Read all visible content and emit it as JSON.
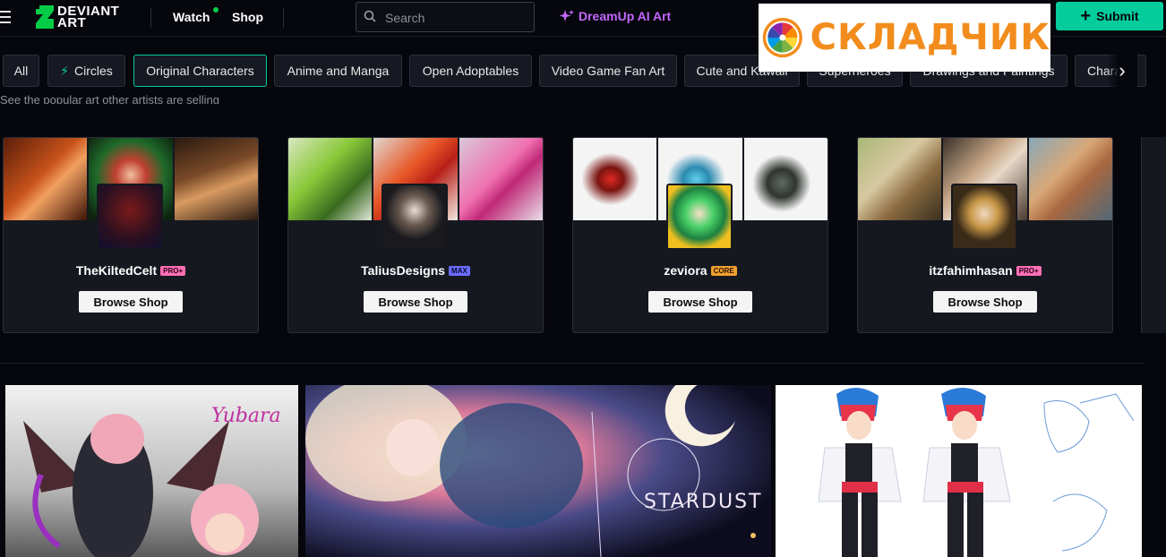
{
  "header": {
    "logo_line1": "DEVIANT",
    "logo_line2": "ART",
    "watch_label": "Watch",
    "shop_label": "Shop",
    "search_placeholder": "Search",
    "dreamup_label": "DreamUp AI Art",
    "submit_label": "Submit"
  },
  "watermark": {
    "text": "СКЛАДЧИК"
  },
  "categories": [
    {
      "label": "All"
    },
    {
      "label": "Circles"
    },
    {
      "label": "Original Characters",
      "active": true
    },
    {
      "label": "Anime and Manga"
    },
    {
      "label": "Open Adoptables"
    },
    {
      "label": "Video Game Fan Art"
    },
    {
      "label": "Cute and Kawaii"
    },
    {
      "label": "Superheroes"
    },
    {
      "label": "Drawings and Paintings"
    },
    {
      "label": "Characte"
    }
  ],
  "section": {
    "subtitle": "See the popular art other artists are selling"
  },
  "shops": [
    {
      "username": "TheKiltedCelt",
      "badge": "PRO+",
      "badge_color": "#ff6fb5",
      "button_label": "Browse Shop"
    },
    {
      "username": "TaliusDesigns",
      "badge": "MAX",
      "badge_color": "#6c6cff",
      "button_label": "Browse Shop"
    },
    {
      "username": "zeviora",
      "badge": "CORE",
      "badge_color": "#f0a030",
      "button_label": "Browse Shop"
    },
    {
      "username": "itzfahimhasan",
      "badge": "PRO+",
      "badge_color": "#ff6fb5",
      "button_label": "Browse Shop"
    }
  ],
  "artworks": [
    {
      "caption": "Yubara"
    },
    {
      "caption": "STARDUST"
    },
    {
      "caption": ""
    }
  ],
  "colors": {
    "accent": "#05cc9d",
    "dreamup": "#c467ff",
    "background": "#06070d",
    "card": "#15181f"
  }
}
